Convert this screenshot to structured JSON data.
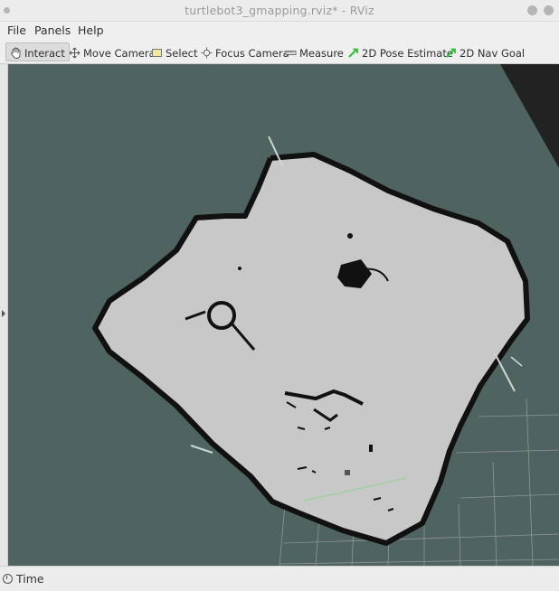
{
  "window": {
    "title": "turtlebot3_gmapping.rviz* - RViz"
  },
  "menu": [
    {
      "label": "File"
    },
    {
      "label": "Panels"
    },
    {
      "label": "Help"
    }
  ],
  "toolbar": {
    "tools": [
      {
        "label": "Interact",
        "icon": "hand-icon",
        "active": true
      },
      {
        "label": "Move Camera",
        "icon": "move-camera-icon",
        "active": false
      },
      {
        "label": "Select",
        "icon": "select-icon",
        "active": false
      },
      {
        "label": "Focus Camera",
        "icon": "focus-camera-icon",
        "active": false
      },
      {
        "label": "Measure",
        "icon": "ruler-icon",
        "active": false
      },
      {
        "label": "2D Pose Estimate",
        "icon": "green-arrow-icon",
        "active": false
      },
      {
        "label": "2D Nav Goal",
        "icon": "green-arrow-icon",
        "active": false
      }
    ]
  },
  "status": {
    "label": "Time"
  },
  "colors": {
    "viewport_bg": "#4f6361",
    "free_space": "#c8c8c8",
    "obstacle": "#111111",
    "grid": "#8f9695",
    "accent_green": "#2fbf3a"
  }
}
